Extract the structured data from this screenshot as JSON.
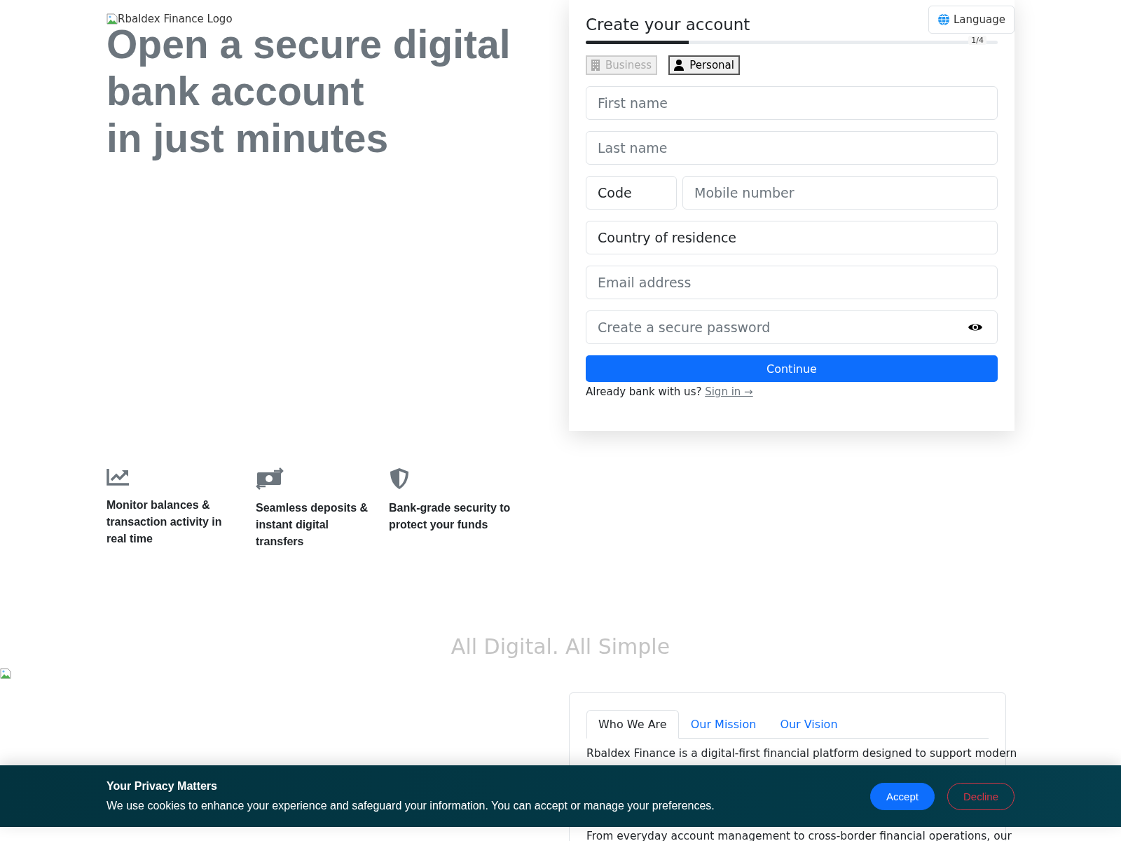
{
  "logo_alt": "Rbaldex Finance Logo",
  "headline": {
    "lines": [
      "Open a secure digital bank account",
      "in just minutes"
    ]
  },
  "signup": {
    "title": "Create your account",
    "language_button": "Language",
    "step": "1/4",
    "progress": {
      "level": 0.25
    },
    "account_types": [
      {
        "label": "Business",
        "kind": "business",
        "selected": false
      },
      {
        "label": "Personal",
        "kind": "personal",
        "selected": true
      }
    ],
    "fields": [
      {
        "kind": "text",
        "placeholder": "First name"
      },
      {
        "kind": "text",
        "placeholder": "Last name"
      },
      {
        "kind": "phone",
        "code": "Code",
        "placeholder": "Mobile number"
      },
      {
        "kind": "select",
        "value": "Country of residence"
      },
      {
        "kind": "text",
        "placeholder": "Email address"
      },
      {
        "kind": "password",
        "placeholder": "Create a secure password"
      }
    ],
    "continue_button": "Continue",
    "signin_prompt": "Already bank with us?",
    "signin_link": "Sign in →"
  },
  "features": [
    {
      "kind": "chart",
      "text": "Monitor balances & transaction activity in real time"
    },
    {
      "kind": "money",
      "text": "Seamless deposits & instant digital transfers"
    },
    {
      "kind": "shield",
      "text": "Bank-grade security to\nprotect your funds"
    }
  ],
  "section_title": "All Digital. All Simple",
  "about": {
    "tabs": [
      {
        "label": "Who We Are",
        "selected": true
      },
      {
        "label": "Our Mission",
        "selected": false
      },
      {
        "label": "Our Vision",
        "selected": false
      }
    ],
    "paragraphs": [
      "Rbaldex Finance is a digital-first financial platform designed to support modern",
      "From everyday account management to cross-border financial operations, our"
    ]
  },
  "cookie_banner": {
    "title": "Your Privacy Matters",
    "text": "We use cookies to enhance your experience and safeguard your information. You can accept or manage your preferences.",
    "accept_button": "Accept",
    "decline_button": "Decline"
  }
}
